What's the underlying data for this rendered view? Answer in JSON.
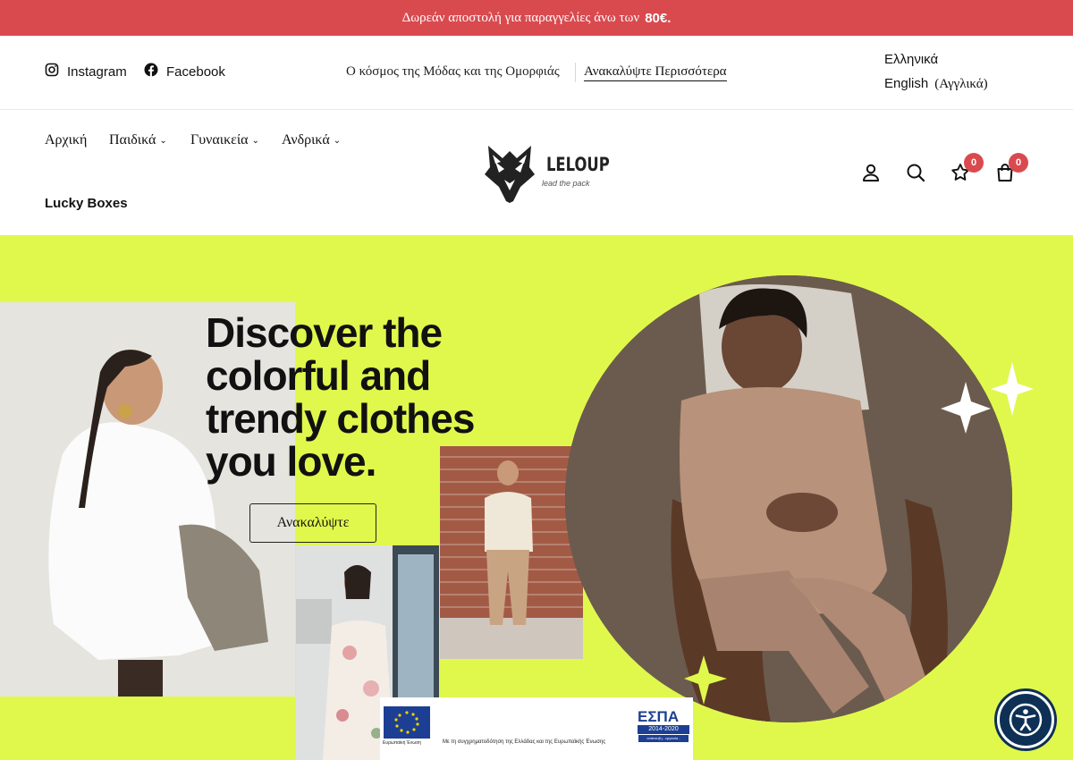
{
  "announcement": {
    "text": "Δωρεάν αποστολή για παραγγελίες άνω των",
    "amount": "80€."
  },
  "topbar": {
    "social": [
      {
        "label": "Instagram",
        "icon": "instagram-icon"
      },
      {
        "label": "Facebook",
        "icon": "facebook-icon"
      }
    ],
    "tagline": "Ο κόσμος της Μόδας και της Ομορφιάς",
    "discover_more": "Ανακαλύψτε Περισσότερα",
    "languages": [
      {
        "label": "Ελληνικά"
      },
      {
        "label": "English",
        "native": "(Αγγλικά)"
      }
    ]
  },
  "nav": {
    "items": [
      {
        "label": "Αρχική"
      },
      {
        "label": "Παιδικά",
        "chevron": "⌄"
      },
      {
        "label": "Γυναικεία",
        "chevron": "⌄"
      },
      {
        "label": "Ανδρικά",
        "chevron": "⌄"
      },
      {
        "label": "Lucky Boxes"
      }
    ]
  },
  "logo": {
    "name": "LELOUP",
    "slogan": "lead the pack"
  },
  "header_icons": {
    "account": "user-icon",
    "search": "search-icon",
    "wishlist": {
      "icon": "star-icon",
      "count": "0"
    },
    "cart": {
      "icon": "bag-icon",
      "count": "0"
    }
  },
  "hero": {
    "headline_lines": [
      "Discover the",
      "colorful and",
      "trendy clothes",
      "you love."
    ],
    "cta_label": "Ανακαλύψτε",
    "accent_color": "#e0f84c"
  },
  "espa_banner": {
    "eu_label": "Ευρωπαϊκή Ένωση",
    "text": "Με τη συγχρηματοδότηση της Ελλάδας και της Ευρωπαϊκής Ένωσης",
    "logo": "ΕΣΠΑ",
    "years": "2014-2020",
    "sub": "ανάπτυξη - εργασία - αλληλεγγύη"
  },
  "accessibility": {
    "icon": "accessibility-icon"
  },
  "colors": {
    "brand_red": "#d94a4f",
    "navy": "#0e3055",
    "lime": "#e0f84c"
  }
}
